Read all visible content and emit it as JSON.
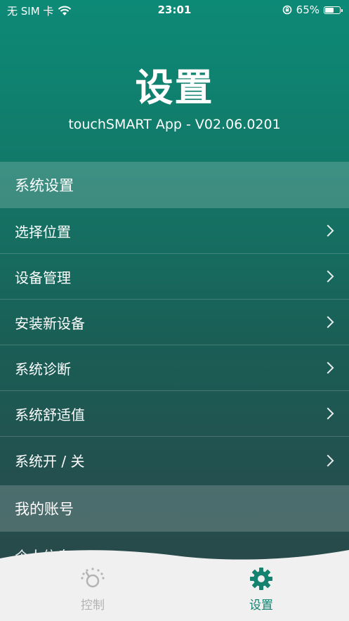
{
  "status_bar": {
    "carrier": "无 SIM 卡",
    "time": "23:01",
    "battery_percent": "65%",
    "battery_level": 0.65
  },
  "header": {
    "title": "设置",
    "app_version": "touchSMART App - V02.06.0201"
  },
  "system_settings": {
    "section_label": "系统设置",
    "items": [
      {
        "label": "选择位置"
      },
      {
        "label": "设备管理"
      },
      {
        "label": "安装新设备"
      },
      {
        "label": "系统诊断"
      },
      {
        "label": "系统舒适值"
      },
      {
        "label": "系统开 / 关"
      }
    ]
  },
  "my_account": {
    "section_label": "我的账号",
    "partial_item": "个人信息"
  },
  "tab_bar": {
    "tabs": [
      {
        "label": "控制",
        "icon": "control-icon",
        "active": false
      },
      {
        "label": "设置",
        "icon": "gear-icon",
        "active": true
      }
    ],
    "active_color": "#13826e",
    "inactive_color": "#b3b3b3"
  }
}
